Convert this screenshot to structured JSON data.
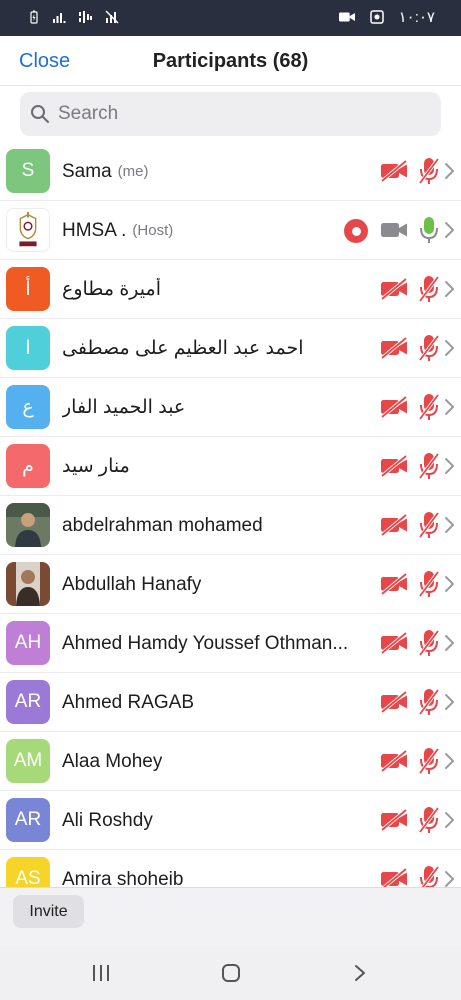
{
  "status_bar": {
    "time": "١٠:٠٧",
    "left_icons": [
      "battery-saver-icon",
      "signal-bars-icon",
      "signal-bars-2-icon",
      "no-signal-icon"
    ],
    "right_icons": [
      "video-call-icon",
      "screenshot-icon"
    ]
  },
  "header": {
    "close_label": "Close",
    "title": "Participants (68)"
  },
  "search": {
    "placeholder": "Search",
    "value": ""
  },
  "participants": [
    {
      "name": "Sama",
      "tag": "(me)",
      "avatar_text": "S",
      "avatar_color": "#7cc77d",
      "camera": "off",
      "mic": "muted",
      "recording": false
    },
    {
      "name": "HMSA .",
      "tag": "(Host)",
      "avatar_text": "HMSA",
      "avatar_color": "#ffffff",
      "camera": "on",
      "mic": "on",
      "recording": true
    },
    {
      "name": "أميرة مطاوع",
      "tag": "",
      "avatar_text": "أ",
      "avatar_color": "#ef5b23",
      "camera": "off",
      "mic": "muted",
      "recording": false
    },
    {
      "name": "احمد عبد العظيم على مصطفى",
      "tag": "",
      "avatar_text": "ا",
      "avatar_color": "#4fcfd9",
      "camera": "off",
      "mic": "muted",
      "recording": false
    },
    {
      "name": "عبد الحميد الفار",
      "tag": "",
      "avatar_text": "ع",
      "avatar_color": "#55b0ef",
      "camera": "off",
      "mic": "muted",
      "recording": false
    },
    {
      "name": "منار سيد",
      "tag": "",
      "avatar_text": "م",
      "avatar_color": "#f46a6a",
      "camera": "off",
      "mic": "muted",
      "recording": false
    },
    {
      "name": "abdelrahman mohamed",
      "tag": "",
      "avatar_text": "",
      "avatar_color": "#5d6b55",
      "camera": "off",
      "mic": "muted",
      "recording": false
    },
    {
      "name": "Abdullah Hanafy",
      "tag": "",
      "avatar_text": "",
      "avatar_color": "#8a6a55",
      "camera": "off",
      "mic": "muted",
      "recording": false
    },
    {
      "name": "Ahmed Hamdy Youssef Othman...",
      "tag": "",
      "avatar_text": "AH",
      "avatar_color": "#c07fd6",
      "camera": "off",
      "mic": "muted",
      "recording": false
    },
    {
      "name": "Ahmed RAGAB",
      "tag": "",
      "avatar_text": "AR",
      "avatar_color": "#9b79d6",
      "camera": "off",
      "mic": "muted",
      "recording": false
    },
    {
      "name": "Alaa Mohey",
      "tag": "",
      "avatar_text": "AM",
      "avatar_color": "#a6d97a",
      "camera": "off",
      "mic": "muted",
      "recording": false
    },
    {
      "name": "Ali Roshdy",
      "tag": "",
      "avatar_text": "AR",
      "avatar_color": "#7986d6",
      "camera": "off",
      "mic": "muted",
      "recording": false
    },
    {
      "name": "Amira shoheib",
      "tag": "",
      "avatar_text": "AS",
      "avatar_color": "#f6d428",
      "camera": "off",
      "mic": "muted",
      "recording": false
    }
  ],
  "footer": {
    "invite_label": "Invite"
  },
  "nav": {
    "icons": [
      "recent-apps-icon",
      "home-icon",
      "back-icon"
    ]
  },
  "colors": {
    "accent": "#1f6fd6",
    "muted_red": "#e8474a",
    "mic_green": "#6cc04a",
    "camera_gray": "#8a8a90"
  }
}
